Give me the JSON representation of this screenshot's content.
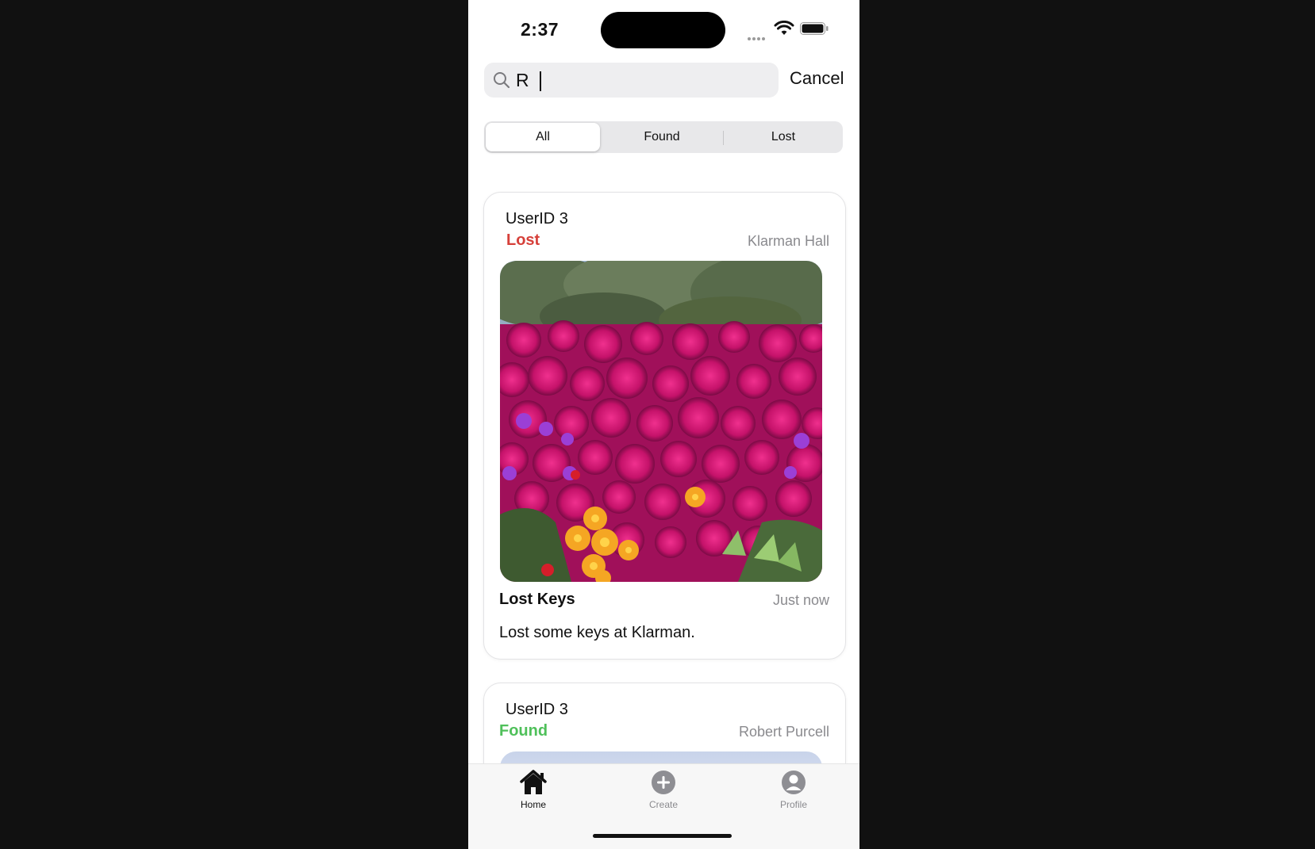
{
  "status_bar": {
    "time": "2:37"
  },
  "search": {
    "value": "R",
    "cancel_label": "Cancel"
  },
  "segments": [
    {
      "label": "All",
      "selected": true
    },
    {
      "label": "Found",
      "selected": false
    },
    {
      "label": "Lost",
      "selected": false
    }
  ],
  "posts": [
    {
      "user": "UserID 3",
      "status": "Lost",
      "location": "Klarman Hall",
      "title": "Lost Keys",
      "time": "Just now",
      "description": "Lost some keys at Klarman.",
      "image": "flower-field-photo"
    },
    {
      "user": "UserID 3",
      "status": "Found",
      "location": "Robert Purcell",
      "image": "photo"
    }
  ],
  "colors": {
    "lost": "#d6403a",
    "found": "#4fc05a",
    "accent": "#111111"
  },
  "tab_bar": {
    "items": [
      {
        "label": "Home",
        "icon": "home-icon",
        "active": true
      },
      {
        "label": "Create",
        "icon": "plus-circle-icon",
        "active": false
      },
      {
        "label": "Profile",
        "icon": "person-circle-icon",
        "active": false
      }
    ]
  }
}
